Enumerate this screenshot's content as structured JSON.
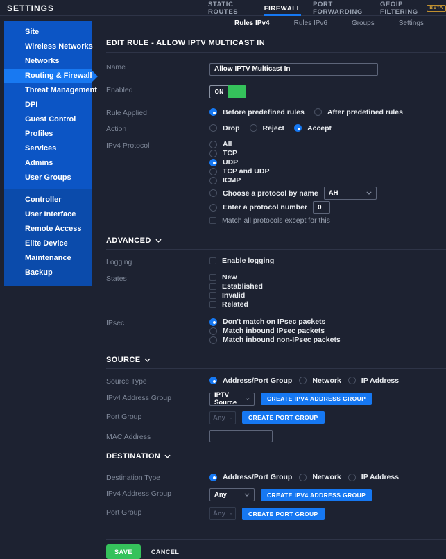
{
  "app": {
    "title": "SETTINGS"
  },
  "colors": {
    "accent_blue": "#1678f2",
    "sidebar_blue": "#0c55c5",
    "sidebar_secondary_blue": "#0b4bab",
    "selected_item_blue": "#1879f2",
    "success_green": "#35c25b",
    "beta_orange": "#d4a23c",
    "background": "#1d2231"
  },
  "sidebar": {
    "selected": "Routing & Firewall",
    "primary_items": [
      "Site",
      "Wireless Networks",
      "Networks",
      "Routing & Firewall",
      "Threat Management",
      "DPI",
      "Guest Control",
      "Profiles",
      "Services",
      "Admins",
      "User Groups"
    ],
    "secondary_items": [
      "Controller",
      "User Interface",
      "Remote Access",
      "Elite Device",
      "Maintenance",
      "Backup"
    ]
  },
  "tabs": {
    "items": [
      "STATIC ROUTES",
      "FIREWALL",
      "PORT FORWARDING",
      "GEOIP FILTERING"
    ],
    "active": "FIREWALL",
    "beta_badge": "BETA"
  },
  "subtabs": {
    "items": [
      "Rules IPv4",
      "Rules IPv6",
      "Groups",
      "Settings"
    ],
    "active": "Rules IPv4"
  },
  "form": {
    "heading": "EDIT RULE - ALLOW IPTV MULTICAST IN",
    "name": {
      "label": "Name",
      "value": "Allow IPTV Multicast In"
    },
    "enabled": {
      "label": "Enabled",
      "state": "ON"
    },
    "rule_applied": {
      "label": "Rule Applied",
      "options": [
        "Before predefined rules",
        "After predefined rules"
      ],
      "selected": "Before predefined rules"
    },
    "action": {
      "label": "Action",
      "options": [
        "Drop",
        "Reject",
        "Accept"
      ],
      "selected": "Accept"
    },
    "ipv4_protocol": {
      "label": "IPv4 Protocol",
      "options": [
        "All",
        "TCP",
        "UDP",
        "TCP and UDP",
        "ICMP"
      ],
      "selected": "UDP",
      "protocol_by_name": {
        "label": "Choose a protocol by name",
        "value": "AH"
      },
      "protocol_number": {
        "label": "Enter a protocol number",
        "value": "0"
      },
      "match_all_except": {
        "label": "Match all protocols except for this",
        "checked": false
      }
    },
    "advanced": {
      "heading": "ADVANCED",
      "logging": {
        "label": "Logging",
        "option": "Enable logging",
        "checked": false
      },
      "states": {
        "label": "States",
        "options": [
          "New",
          "Established",
          "Invalid",
          "Related"
        ],
        "checked": []
      },
      "ipsec": {
        "label": "IPsec",
        "options": [
          "Don't match on IPsec packets",
          "Match inbound IPsec packets",
          "Match inbound non-IPsec packets"
        ],
        "selected": "Don't match on IPsec packets"
      }
    },
    "source": {
      "heading": "SOURCE",
      "type": {
        "label": "Source Type",
        "options": [
          "Address/Port Group",
          "Network",
          "IP Address"
        ],
        "selected": "Address/Port Group"
      },
      "ipv4_address_group": {
        "label": "IPv4 Address Group",
        "value": "IPTV Source",
        "button": "CREATE IPV4 ADDRESS GROUP"
      },
      "port_group": {
        "label": "Port Group",
        "value": "Any",
        "disabled": true,
        "button": "CREATE PORT GROUP"
      },
      "mac_address": {
        "label": "MAC Address",
        "value": ""
      }
    },
    "destination": {
      "heading": "DESTINATION",
      "type": {
        "label": "Destination Type",
        "options": [
          "Address/Port Group",
          "Network",
          "IP Address"
        ],
        "selected": "Address/Port Group"
      },
      "ipv4_address_group": {
        "label": "IPv4 Address Group",
        "value": "Any",
        "button": "CREATE IPV4 ADDRESS GROUP"
      },
      "port_group": {
        "label": "Port Group",
        "value": "Any",
        "disabled": true,
        "button": "CREATE PORT GROUP"
      }
    },
    "footer": {
      "save": "SAVE",
      "cancel": "CANCEL"
    }
  }
}
